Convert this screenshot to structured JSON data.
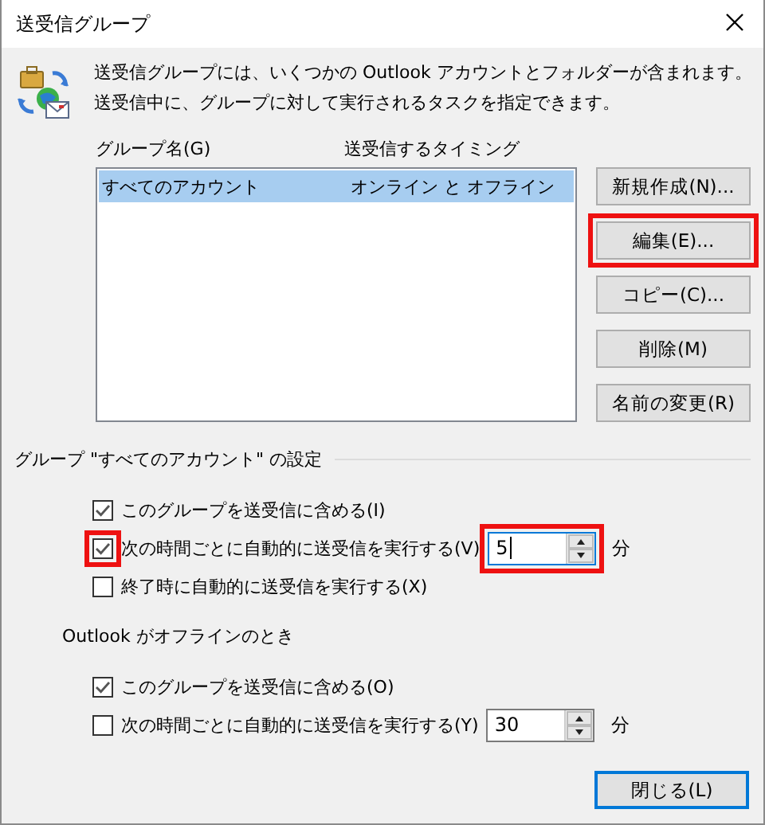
{
  "window": {
    "title": "送受信グループ"
  },
  "description": "送受信グループには、いくつかの Outlook アカウントとフォルダーが含まれます。送受信中に、グループに対して実行されるタスクを指定できます。",
  "list": {
    "columns": [
      "グループ名(G)",
      "送受信するタイミング"
    ],
    "rows": [
      {
        "cells": [
          "すべてのアカウント",
          "オンライン と オフライン"
        ],
        "selected": true
      }
    ]
  },
  "buttons": [
    {
      "label": "新規作成(N)...",
      "highlighted": false
    },
    {
      "label": "編集(E)...",
      "highlighted": true
    },
    {
      "label": "コピー(C)...",
      "highlighted": false
    },
    {
      "label": "削除(M)",
      "highlighted": false
    },
    {
      "label": "名前の変更(R)",
      "highlighted": false
    }
  ],
  "sections": [
    {
      "title": "グループ \"すべてのアカウント\" の設定",
      "ruled": true,
      "options": [
        {
          "kind": "checkbox",
          "label": "このグループを送受信に含める(I)",
          "checked": true,
          "highlighted": false
        },
        {
          "kind": "interval",
          "label": "次の時間ごとに自動的に送受信を実行する(V)",
          "checked": true,
          "highlighted": true,
          "value": "5",
          "unit": "分",
          "focused": true,
          "value_highlighted": true
        },
        {
          "kind": "checkbox",
          "label": "終了時に自動的に送受信を実行する(X)",
          "checked": false,
          "highlighted": false
        }
      ]
    },
    {
      "title": "Outlook がオフラインのとき",
      "ruled": false,
      "options": [
        {
          "kind": "checkbox",
          "label": "このグループを送受信に含める(O)",
          "checked": true,
          "highlighted": false
        },
        {
          "kind": "interval",
          "label": "次の時間ごとに自動的に送受信を実行する(Y)",
          "checked": false,
          "highlighted": false,
          "value": "30",
          "unit": "分",
          "focused": false,
          "value_highlighted": false
        }
      ]
    }
  ],
  "close_button": {
    "label": "閉じる(L)",
    "default": true
  }
}
